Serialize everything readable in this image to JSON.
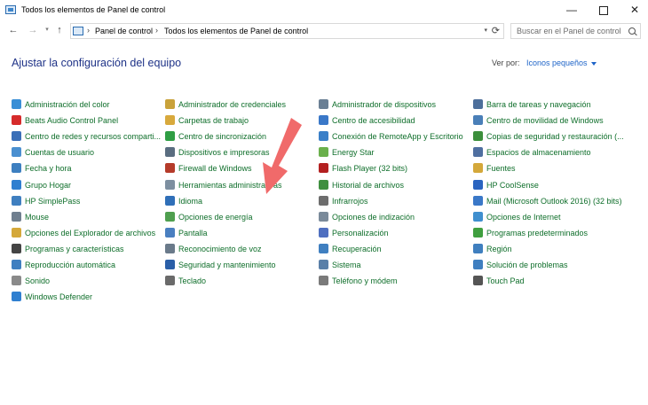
{
  "window": {
    "title": "Todos los elementos de Panel de control",
    "minimize": "—",
    "close": "✕"
  },
  "nav": {
    "back": "←",
    "forward": "→",
    "up": "↑",
    "history": "▾",
    "breadcrumb": [
      "Panel de control",
      "Todos los elementos de Panel de control"
    ],
    "breadcrumb_sep": "›",
    "dropdown": "▾",
    "refresh": "⟳"
  },
  "search": {
    "placeholder": "Buscar en el Panel de control"
  },
  "header": {
    "title": "Ajustar la configuración del equipo",
    "view_by_label": "Ver por:",
    "view_by_value": "Iconos pequeños"
  },
  "items": [
    [
      "Administración del color",
      "Administrador de credenciales",
      "Administrador de dispositivos",
      "Barra de tareas y navegación"
    ],
    [
      "Beats Audio Control Panel",
      "Carpetas de trabajo",
      "Centro de accesibilidad",
      "Centro de movilidad de Windows"
    ],
    [
      "Centro de redes y recursos comparti...",
      "Centro de sincronización",
      "Conexión de RemoteApp y Escritorio",
      "Copias de seguridad y restauración (..."
    ],
    [
      "Cuentas de usuario",
      "Dispositivos e impresoras",
      "Energy Star",
      "Espacios de almacenamiento"
    ],
    [
      "Fecha y hora",
      "Firewall de Windows",
      "Flash Player (32 bits)",
      "Fuentes"
    ],
    [
      "Grupo Hogar",
      "Herramientas administrativas",
      "Historial de archivos",
      "HP CoolSense"
    ],
    [
      "HP SimplePass",
      "Idioma",
      "Infrarrojos",
      "Mail (Microsoft Outlook 2016) (32 bits)"
    ],
    [
      "Mouse",
      "Opciones de energía",
      "Opciones de indización",
      "Opciones de Internet"
    ],
    [
      "Opciones del Explorador de archivos",
      "Pantalla",
      "Personalización",
      "Programas predeterminados"
    ],
    [
      "Programas y características",
      "Reconocimiento de voz",
      "Recuperación",
      "Región"
    ],
    [
      "Reproducción automática",
      "Seguridad y mantenimiento",
      "Sistema",
      "Solución de problemas"
    ],
    [
      "Sonido",
      "Teclado",
      "Teléfono y módem",
      "Touch Pad"
    ],
    [
      "Windows Defender"
    ]
  ],
  "icon_colors": [
    [
      "#3a8fd6",
      "#c9a23a",
      "#6a7f94",
      "#4d6f9b"
    ],
    [
      "#d62b2b",
      "#d8a93c",
      "#3a78c8",
      "#4a7fb8"
    ],
    [
      "#3a6fb8",
      "#2f9e44",
      "#3a7fc8",
      "#3c8f3c"
    ],
    [
      "#4a8fd0",
      "#5a6d80",
      "#6ab04c",
      "#4f6fa0"
    ],
    [
      "#3d7fc0",
      "#b53b2a",
      "#b32020",
      "#d4a83a"
    ],
    [
      "#2f7fd0",
      "#7d8fa0",
      "#3f8f3f",
      "#2a64c0"
    ],
    [
      "#3f7fc0",
      "#2f6fb8",
      "#6d6d6d",
      "#3a78c8"
    ],
    [
      "#6f7f8f",
      "#4f9f4f",
      "#7a8a9a",
      "#3f8fcf"
    ],
    [
      "#d4a83a",
      "#4a7fc0",
      "#4f6fc0",
      "#3f9f3f"
    ],
    [
      "#444444",
      "#6a7a8a",
      "#3f7fc0",
      "#3f7fbf"
    ],
    [
      "#3f7fc0",
      "#2a5fa8",
      "#5a7fa8",
      "#3f7fc0"
    ],
    [
      "#8a8a8a",
      "#6a6a6a",
      "#7a7a7a",
      "#555555"
    ],
    [
      "#2f7fd0"
    ]
  ],
  "accent": {
    "heading": "#1e3287",
    "item_text": "#0e6e2a",
    "link": "#1e64c8",
    "arrow": "#f06a6a"
  }
}
